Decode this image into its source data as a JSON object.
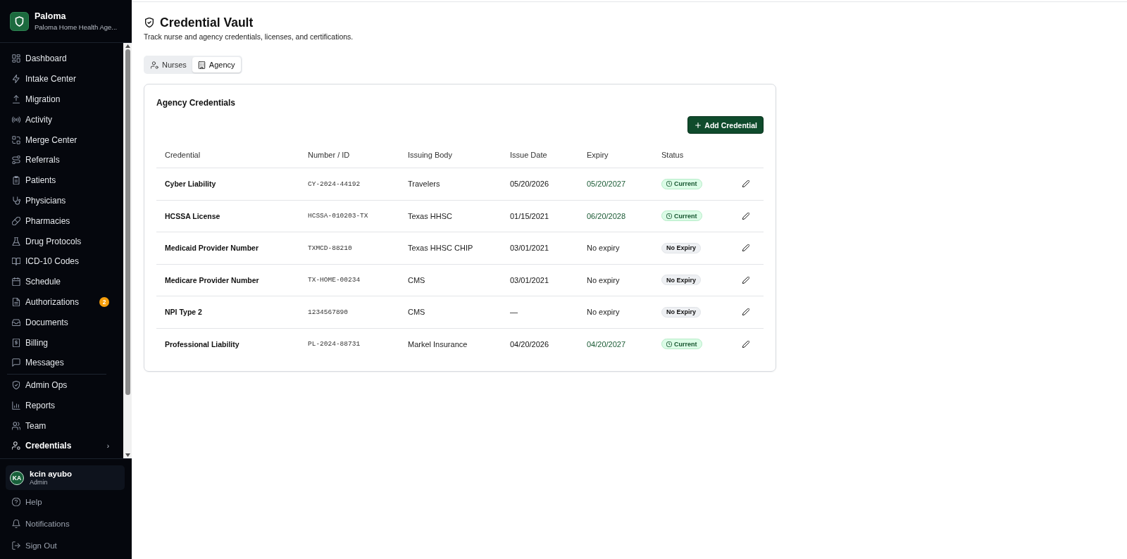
{
  "sidebar": {
    "brand": {
      "name": "Paloma",
      "subtitle": "Paloma Home Health Age..."
    },
    "nav_groups": [
      {
        "items": [
          {
            "label": "Dashboard",
            "selected": false
          },
          {
            "label": "Intake Center",
            "selected": false
          },
          {
            "label": "Migration",
            "selected": false
          },
          {
            "label": "Activity",
            "selected": false
          },
          {
            "label": "Merge Center",
            "selected": false
          },
          {
            "label": "Referrals",
            "selected": false
          },
          {
            "label": "Patients",
            "selected": false
          },
          {
            "label": "Physicians",
            "selected": false
          },
          {
            "label": "Pharmacies",
            "selected": false
          },
          {
            "label": "Drug Protocols",
            "selected": false
          },
          {
            "label": "ICD-10 Codes",
            "selected": false
          },
          {
            "label": "Schedule",
            "selected": false
          },
          {
            "label": "Authorizations",
            "selected": false,
            "badge": "2"
          },
          {
            "label": "Documents",
            "selected": false
          },
          {
            "label": "Billing",
            "selected": false
          },
          {
            "label": "Messages",
            "selected": false
          }
        ]
      },
      {
        "items": [
          {
            "label": "Admin Ops",
            "selected": false
          },
          {
            "label": "Reports",
            "selected": false
          },
          {
            "label": "Team",
            "selected": false
          },
          {
            "label": "Credentials",
            "selected": true,
            "chevron": "›"
          }
        ]
      }
    ],
    "user": {
      "initials": "KA",
      "name": "kcin ayubo",
      "role": "Admin"
    },
    "footer_links": [
      {
        "label": "Help"
      },
      {
        "label": "Notifications"
      },
      {
        "label": "Sign Out"
      }
    ]
  },
  "page": {
    "title": "Credential Vault",
    "subtitle": "Track nurse and agency credentials, licenses, and certifications."
  },
  "tabs": [
    {
      "label": "Nurses",
      "selected": false
    },
    {
      "label": "Agency",
      "selected": true
    }
  ],
  "card": {
    "title": "Agency Credentials",
    "add_button": {
      "label": "Add Credential"
    }
  },
  "table": {
    "columns": [
      "Credential",
      "Number / ID",
      "Issuing Body",
      "Issue Date",
      "Expiry",
      "Status"
    ],
    "rows": [
      {
        "credential": "Cyber Liability",
        "number": "CY-2024-44192",
        "issuing_body": "Travelers",
        "issue_date": "05/20/2026",
        "expiry": "05/20/2027",
        "status": {
          "label": "Current",
          "kind": "current"
        }
      },
      {
        "credential": "HCSSA License",
        "number": "HCSSA-010203-TX",
        "issuing_body": "Texas HHSC",
        "issue_date": "01/15/2021",
        "expiry": "06/20/2028",
        "status": {
          "label": "Current",
          "kind": "current"
        }
      },
      {
        "credential": "Medicaid Provider Number",
        "number": "TXMCD-88210",
        "issuing_body": "Texas HHSC CHIP",
        "issue_date": "03/01/2021",
        "expiry": "No expiry",
        "status": {
          "label": "No Expiry",
          "kind": "none"
        }
      },
      {
        "credential": "Medicare Provider Number",
        "number": "TX-HOME-00234",
        "issuing_body": "CMS",
        "issue_date": "03/01/2021",
        "expiry": "No expiry",
        "status": {
          "label": "No Expiry",
          "kind": "none"
        }
      },
      {
        "credential": "NPI Type 2",
        "number": "1234567890",
        "issuing_body": "CMS",
        "issue_date": "—",
        "expiry": "No expiry",
        "status": {
          "label": "No Expiry",
          "kind": "none"
        }
      },
      {
        "credential": "Professional Liability",
        "number": "PL-2024-88731",
        "issuing_body": "Markel Insurance",
        "issue_date": "04/20/2026",
        "expiry": "04/20/2027",
        "status": {
          "label": "Current",
          "kind": "current"
        }
      }
    ]
  }
}
